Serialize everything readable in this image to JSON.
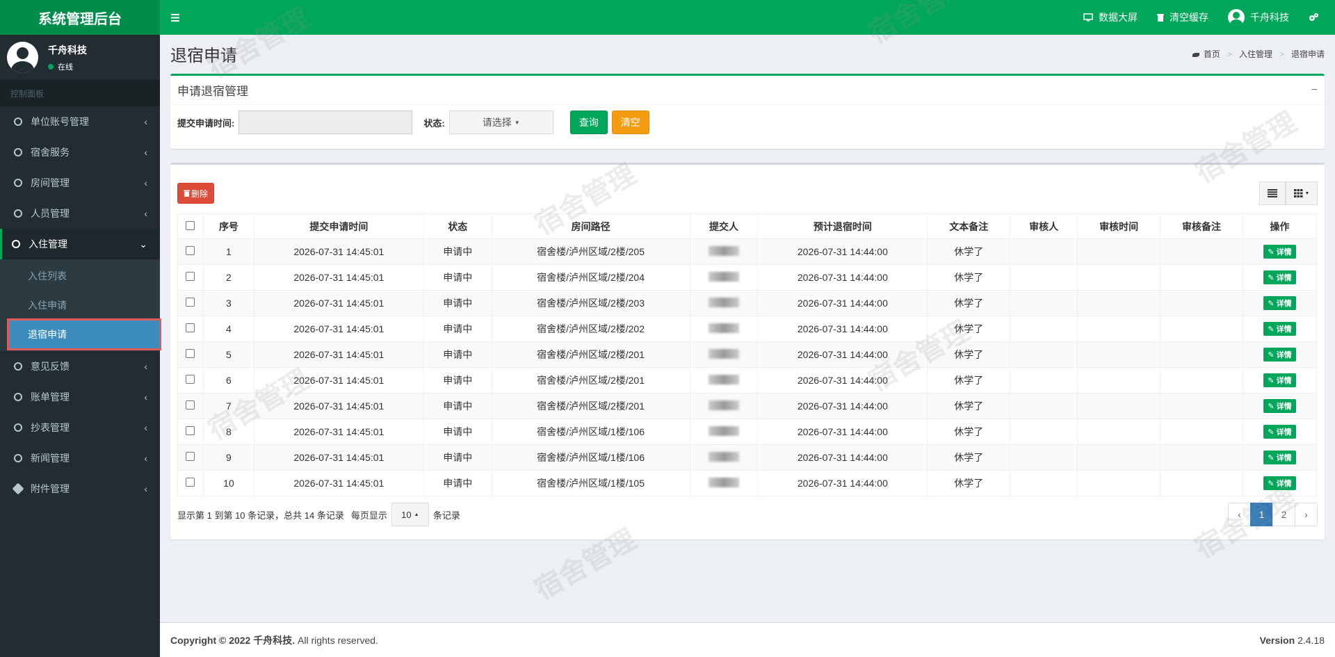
{
  "header": {
    "logo": "系统管理后台",
    "links": {
      "dashboard": "数据大屏",
      "clear_cache": "清空缓存",
      "user": "千舟科技"
    }
  },
  "sidebar": {
    "user_name": "千舟科技",
    "user_status": "在线",
    "section": "控制面板",
    "items": [
      {
        "label": "单位账号管理"
      },
      {
        "label": "宿舍服务"
      },
      {
        "label": "房间管理"
      },
      {
        "label": "人员管理"
      },
      {
        "label": "入住管理"
      },
      {
        "label": "意见反馈"
      },
      {
        "label": "账单管理"
      },
      {
        "label": "抄表管理"
      },
      {
        "label": "新闻管理"
      },
      {
        "label": "附件管理"
      }
    ],
    "sub_items": [
      {
        "label": "入住列表"
      },
      {
        "label": "入住申请"
      },
      {
        "label": "退宿申请"
      }
    ]
  },
  "page": {
    "title": "退宿申请",
    "breadcrumb": [
      "首页",
      "入住管理",
      "退宿申请"
    ]
  },
  "search": {
    "box_title": "申请退宿管理",
    "time_label": "提交申请时间:",
    "status_label": "状态:",
    "status_value": "请选择",
    "query_btn": "查询",
    "clear_btn": "清空"
  },
  "table": {
    "delete_btn": "删除",
    "columns": [
      "序号",
      "提交申请时间",
      "状态",
      "房间路径",
      "提交人",
      "预计退宿时间",
      "文本备注",
      "审核人",
      "审核时间",
      "审核备注",
      "操作"
    ],
    "detail_btn": "详情",
    "rows": [
      {
        "no": "1",
        "time": "2026-07-31 14:45:01",
        "status": "申请中",
        "room": "宿舍楼/泸州区域/2楼/205",
        "leave": "2026-07-31 14:44:00",
        "note": "休学了"
      },
      {
        "no": "2",
        "time": "2026-07-31 14:45:01",
        "status": "申请中",
        "room": "宿舍楼/泸州区域/2楼/204",
        "leave": "2026-07-31 14:44:00",
        "note": "休学了"
      },
      {
        "no": "3",
        "time": "2026-07-31 14:45:01",
        "status": "申请中",
        "room": "宿舍楼/泸州区域/2楼/203",
        "leave": "2026-07-31 14:44:00",
        "note": "休学了"
      },
      {
        "no": "4",
        "time": "2026-07-31 14:45:01",
        "status": "申请中",
        "room": "宿舍楼/泸州区域/2楼/202",
        "leave": "2026-07-31 14:44:00",
        "note": "休学了"
      },
      {
        "no": "5",
        "time": "2026-07-31 14:45:01",
        "status": "申请中",
        "room": "宿舍楼/泸州区域/2楼/201",
        "leave": "2026-07-31 14:44:00",
        "note": "休学了"
      },
      {
        "no": "6",
        "time": "2026-07-31 14:45:01",
        "status": "申请中",
        "room": "宿舍楼/泸州区域/2楼/201",
        "leave": "2026-07-31 14:44:00",
        "note": "休学了"
      },
      {
        "no": "7",
        "time": "2026-07-31 14:45:01",
        "status": "申请中",
        "room": "宿舍楼/泸州区域/2楼/201",
        "leave": "2026-07-31 14:44:00",
        "note": "休学了"
      },
      {
        "no": "8",
        "time": "2026-07-31 14:45:01",
        "status": "申请中",
        "room": "宿舍楼/泸州区域/1楼/106",
        "leave": "2026-07-31 14:44:00",
        "note": "休学了"
      },
      {
        "no": "9",
        "time": "2026-07-31 14:45:01",
        "status": "申请中",
        "room": "宿舍楼/泸州区域/1楼/106",
        "leave": "2026-07-31 14:44:00",
        "note": "休学了"
      },
      {
        "no": "10",
        "time": "2026-07-31 14:45:01",
        "status": "申请中",
        "room": "宿舍楼/泸州区域/1楼/105",
        "leave": "2026-07-31 14:44:00",
        "note": "休学了"
      }
    ]
  },
  "pager": {
    "info": "显示第 1 到第 10 条记录，总共 14 条记录",
    "per_page_prefix": "每页显示",
    "per_page_value": "10",
    "per_page_suffix": "条记录",
    "prev": "‹",
    "pages": [
      "1",
      "2"
    ],
    "next": "›"
  },
  "footer": {
    "copyright_prefix": "Copyright © 2022",
    "copyright_company": "千舟科技.",
    "copyright_suffix": "All rights reserved.",
    "version_label": "Version",
    "version": "2.4.18"
  },
  "watermark": "宿舍管理",
  "colors": {
    "primary": "#00a65a",
    "sidebar": "#222d32",
    "selected": "#3c8dbc",
    "danger": "#dd4b39",
    "warning": "#f39c12"
  }
}
